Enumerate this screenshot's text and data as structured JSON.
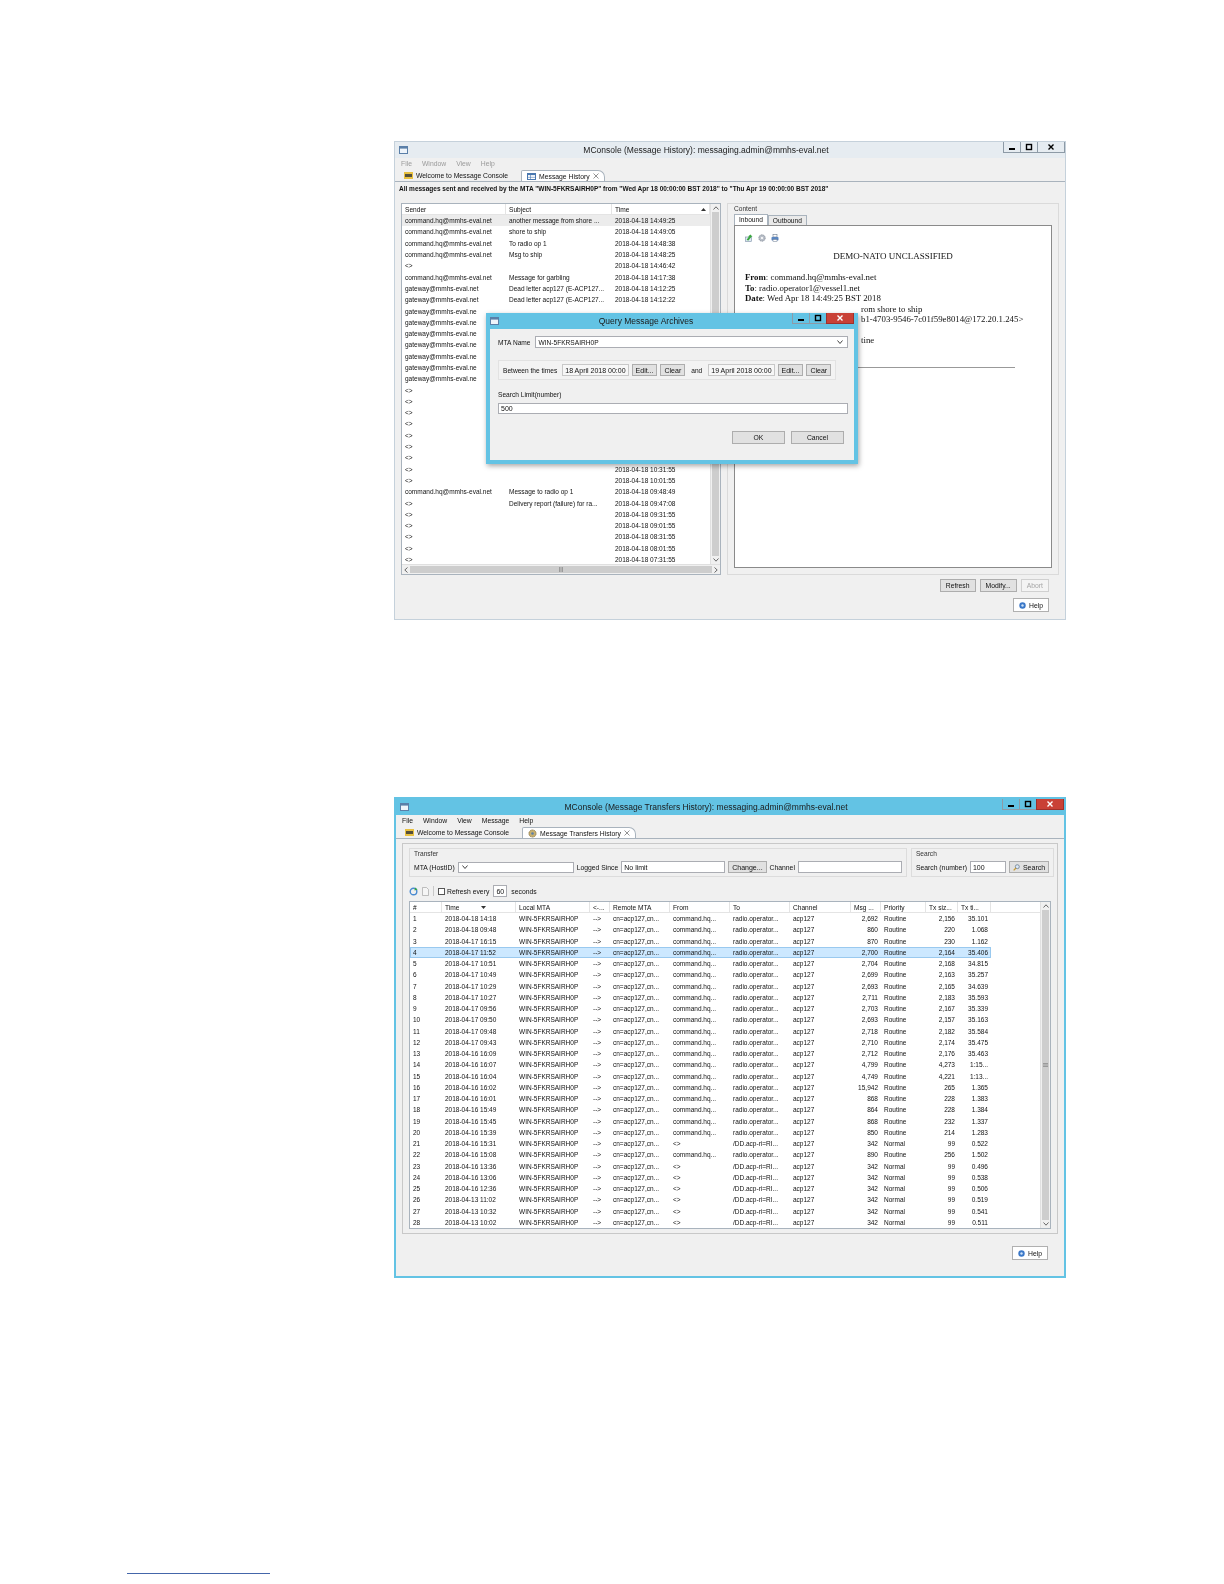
{
  "message_history_window": {
    "title": "MConsole (Message History): messaging.admin@mmhs-eval.net",
    "active": false,
    "menu": [
      {
        "label": "File",
        "disabled": true
      },
      {
        "label": "Window",
        "disabled": true
      },
      {
        "label": "View",
        "disabled": true
      },
      {
        "label": "Help",
        "disabled": true
      }
    ],
    "tabs": [
      {
        "label": "Welcome to Message Console",
        "selected": false,
        "closable": false
      },
      {
        "label": "Message History",
        "selected": true,
        "closable": true
      }
    ],
    "summary": "All messages sent and received by the MTA \"WIN-5FKRSAIRH0P\" from \"Wed Apr 18 00:00:00 BST 2018\" to \"Thu Apr 19 00:00:00 BST 2018\"",
    "table": {
      "columns": [
        {
          "label": "Sender",
          "sorted": false
        },
        {
          "label": "Subject",
          "sorted": false
        },
        {
          "label": "Time",
          "sorted": true,
          "descending": false
        }
      ],
      "rows": [
        {
          "sender": "command.hq@mmhs-eval.net",
          "subject": "another message from shore ...",
          "time": "2018-04-18 14:49:25",
          "selected": true
        },
        {
          "sender": "command.hq@mmhs-eval.net",
          "subject": "shore to ship",
          "time": "2018-04-18 14:49:05",
          "selected": false
        },
        {
          "sender": "command.hq@mmhs-eval.net",
          "subject": "To radio op 1",
          "time": "2018-04-18 14:48:38",
          "selected": false
        },
        {
          "sender": "command.hq@mmhs-eval.net",
          "subject": "Msg to ship",
          "time": "2018-04-18 14:48:25",
          "selected": false
        },
        {
          "sender": "<>",
          "time": "2018-04-18 14:46:42",
          "selected": false
        },
        {
          "sender": "command.hq@mmhs-eval.net",
          "subject": "Message for garbling",
          "time": "2018-04-18 14:17:38",
          "selected": false
        },
        {
          "sender": "gateway@mmhs-eval.net",
          "subject": "Dead letter acp127 (E-ACP127...",
          "time": "2018-04-18 14:12:25",
          "selected": false
        },
        {
          "sender": "gateway@mmhs-eval.net",
          "subject": "Dead letter acp127 (E-ACP127...",
          "time": "2018-04-18 14:12:22",
          "selected": false
        },
        {
          "sender": "gateway@mmhs-eval.ne",
          "selected": false
        },
        {
          "sender": "gateway@mmhs-eval.ne",
          "selected": false
        },
        {
          "sender": "gateway@mmhs-eval.ne",
          "selected": false
        },
        {
          "sender": "gateway@mmhs-eval.ne",
          "selected": false
        },
        {
          "sender": "gateway@mmhs-eval.ne",
          "selected": false
        },
        {
          "sender": "gateway@mmhs-eval.ne",
          "selected": false
        },
        {
          "sender": "gateway@mmhs-eval.ne",
          "selected": false
        },
        {
          "sender": "<>",
          "selected": false
        },
        {
          "sender": "<>",
          "selected": false
        },
        {
          "sender": "<>",
          "selected": false
        },
        {
          "sender": "<>",
          "selected": false
        },
        {
          "sender": "<>",
          "selected": false
        },
        {
          "sender": "<>",
          "selected": false
        },
        {
          "sender": "<>",
          "selected": false
        },
        {
          "sender": "<>",
          "time": "2018-04-18 10:31:55",
          "selected": false
        },
        {
          "sender": "<>",
          "time": "2018-04-18 10:01:55",
          "selected": false
        },
        {
          "sender": "command.hq@mmhs-eval.net",
          "subject": "Message to radio op 1",
          "time": "2018-04-18 09:48:49",
          "selected": false
        },
        {
          "sender": "<>",
          "subject": "Delivery report (failure) for ra...",
          "time": "2018-04-18 09:47:08",
          "selected": false
        },
        {
          "sender": "<>",
          "time": "2018-04-18 09:31:55",
          "selected": false
        },
        {
          "sender": "<>",
          "time": "2018-04-18 09:01:55",
          "selected": false
        },
        {
          "sender": "<>",
          "time": "2018-04-18 08:31:55",
          "selected": false
        },
        {
          "sender": "<>",
          "time": "2018-04-18 08:01:55",
          "selected": false
        },
        {
          "sender": "<>",
          "time": "2018-04-18 07:31:55",
          "selected": false
        }
      ]
    },
    "content": {
      "label": "Content",
      "tabs": [
        {
          "label": "Inbound",
          "selected": true
        },
        {
          "label": "Outbound",
          "selected": false
        }
      ],
      "classification": "DEMO-NATO UNCLASSIFIED",
      "header_lines": [
        "**From**: command.hq@mmhs-eval.net",
        "**To**: radio.operator1@vessel1.net",
        "**Date**: Wed Apr 18 14:49:25 BST 2018"
      ],
      "covered_lines": [
        "rom shore to ship",
        "b1-4703-9546-7c01f59e8014@172.20.1.245>",
        "tine"
      ]
    },
    "buttons": [
      {
        "label": "Refresh",
        "disabled": false
      },
      {
        "label": "Modify...",
        "disabled": false
      },
      {
        "label": "Abort",
        "disabled": true
      }
    ],
    "help_button": "Help",
    "dialog": {
      "title": "Query Message Archives",
      "active": true,
      "mta_label": "MTA Name",
      "mta_value": "WIN-5FKRSAIRH0P",
      "between_label": "Between the times",
      "and_label": "and",
      "range": [
        {
          "value": "18 April 2018 00:00",
          "edit": "Edit...",
          "clear": "Clear"
        },
        {
          "value": "19 April 2018 00:00",
          "edit": "Edit...",
          "clear": "Clear"
        }
      ],
      "limit_label": "Search Limit(number)",
      "limit_value": "500",
      "buttons": [
        "OK",
        "Cancel"
      ]
    }
  },
  "transfers_window": {
    "title": "MConsole (Message Transfers History): messaging.admin@mmhs-eval.net",
    "active": true,
    "menu": [
      {
        "label": "File",
        "disabled": false
      },
      {
        "label": "Window",
        "disabled": false
      },
      {
        "label": "View",
        "disabled": false
      },
      {
        "label": "Message",
        "disabled": false
      },
      {
        "label": "Help",
        "disabled": false
      }
    ],
    "tabs": [
      {
        "label": "Welcome to Message Console",
        "selected": false,
        "closable": false
      },
      {
        "label": "Message Transfers History",
        "selected": true,
        "closable": true
      }
    ],
    "transfer_group": {
      "label": "Transfer",
      "host_label": "MTA (HostID)",
      "since_label": "Logged Since",
      "since_value": "No limit",
      "change_button": "Change...",
      "channel_label": "Channel"
    },
    "search_group": {
      "label": "Search",
      "number_label": "Search (number)",
      "number_value": "100",
      "search_button": "Search"
    },
    "refresh": {
      "label": "Refresh every",
      "checked": false,
      "interval": "60",
      "unit": "seconds"
    },
    "table": {
      "columns": [
        {
          "label": "#",
          "sorted": false
        },
        {
          "label": "Time",
          "sorted": true,
          "descending": true
        },
        {
          "label": "Local MTA",
          "sorted": false
        },
        {
          "label": "<-...",
          "sorted": false
        },
        {
          "label": "Remote MTA",
          "sorted": false
        },
        {
          "label": "From",
          "sorted": false
        },
        {
          "label": "To",
          "sorted": false
        },
        {
          "label": "Channel",
          "sorted": false
        },
        {
          "label": "Msg ...",
          "sorted": false
        },
        {
          "label": "Priority",
          "sorted": false
        },
        {
          "label": "Tx siz...",
          "sorted": false
        },
        {
          "label": "Tx ti...",
          "sorted": false
        }
      ],
      "rows": [
        {
          "cells": [
            "1",
            "2018-04-18 14:18",
            "WIN-5FKRSAIRH0P",
            "-->",
            "cn=acp127,cn...",
            "command.hq...",
            "radio.operator...",
            "acp127",
            "2,692",
            "Routine",
            "2,156",
            "35.101"
          ],
          "selected": false
        },
        {
          "cells": [
            "2",
            "2018-04-18 09:48",
            "WIN-5FKRSAIRH0P",
            "-->",
            "cn=acp127,cn...",
            "command.hq...",
            "radio.operator...",
            "acp127",
            "860",
            "Routine",
            "220",
            "1.068"
          ],
          "selected": false
        },
        {
          "cells": [
            "3",
            "2018-04-17 16:15",
            "WIN-5FKRSAIRH0P",
            "-->",
            "cn=acp127,cn...",
            "command.hq...",
            "radio.operator...",
            "acp127",
            "870",
            "Routine",
            "230",
            "1.162"
          ],
          "selected": false
        },
        {
          "cells": [
            "4",
            "2018-04-17 11:52",
            "WIN-5FKRSAIRH0P",
            "-->",
            "cn=acp127,cn...",
            "command.hq...",
            "radio.operator...",
            "acp127",
            "2,700",
            "Routine",
            "2,164",
            "35.406"
          ],
          "selected": true
        },
        {
          "cells": [
            "5",
            "2018-04-17 10:51",
            "WIN-5FKRSAIRH0P",
            "-->",
            "cn=acp127,cn...",
            "command.hq...",
            "radio.operator...",
            "acp127",
            "2,704",
            "Routine",
            "2,168",
            "34.815"
          ],
          "selected": false
        },
        {
          "cells": [
            "6",
            "2018-04-17 10:49",
            "WIN-5FKRSAIRH0P",
            "-->",
            "cn=acp127,cn...",
            "command.hq...",
            "radio.operator...",
            "acp127",
            "2,699",
            "Routine",
            "2,163",
            "35.257"
          ],
          "selected": false
        },
        {
          "cells": [
            "7",
            "2018-04-17 10:29",
            "WIN-5FKRSAIRH0P",
            "-->",
            "cn=acp127,cn...",
            "command.hq...",
            "radio.operator...",
            "acp127",
            "2,693",
            "Routine",
            "2,165",
            "34.639"
          ],
          "selected": false
        },
        {
          "cells": [
            "8",
            "2018-04-17 10:27",
            "WIN-5FKRSAIRH0P",
            "-->",
            "cn=acp127,cn...",
            "command.hq...",
            "radio.operator...",
            "acp127",
            "2,711",
            "Routine",
            "2,183",
            "35.593"
          ],
          "selected": false
        },
        {
          "cells": [
            "9",
            "2018-04-17 09:56",
            "WIN-5FKRSAIRH0P",
            "-->",
            "cn=acp127,cn...",
            "command.hq...",
            "radio.operator...",
            "acp127",
            "2,703",
            "Routine",
            "2,167",
            "35.339"
          ],
          "selected": false
        },
        {
          "cells": [
            "10",
            "2018-04-17 09:50",
            "WIN-5FKRSAIRH0P",
            "-->",
            "cn=acp127,cn...",
            "command.hq...",
            "radio.operator...",
            "acp127",
            "2,693",
            "Routine",
            "2,157",
            "35.163"
          ],
          "selected": false
        },
        {
          "cells": [
            "11",
            "2018-04-17 09:48",
            "WIN-5FKRSAIRH0P",
            "-->",
            "cn=acp127,cn...",
            "command.hq...",
            "radio.operator...",
            "acp127",
            "2,718",
            "Routine",
            "2,182",
            "35.584"
          ],
          "selected": false
        },
        {
          "cells": [
            "12",
            "2018-04-17 09:43",
            "WIN-5FKRSAIRH0P",
            "-->",
            "cn=acp127,cn...",
            "command.hq...",
            "radio.operator...",
            "acp127",
            "2,710",
            "Routine",
            "2,174",
            "35.475"
          ],
          "selected": false
        },
        {
          "cells": [
            "13",
            "2018-04-16 16:09",
            "WIN-5FKRSAIRH0P",
            "-->",
            "cn=acp127,cn...",
            "command.hq...",
            "radio.operator...",
            "acp127",
            "2,712",
            "Routine",
            "2,176",
            "35.463"
          ],
          "selected": false
        },
        {
          "cells": [
            "14",
            "2018-04-16 16:07",
            "WIN-5FKRSAIRH0P",
            "-->",
            "cn=acp127,cn...",
            "command.hq...",
            "radio.operator...",
            "acp127",
            "4,799",
            "Routine",
            "4,273",
            "1:15..."
          ],
          "selected": false
        },
        {
          "cells": [
            "15",
            "2018-04-16 16:04",
            "WIN-5FKRSAIRH0P",
            "-->",
            "cn=acp127,cn...",
            "command.hq...",
            "radio.operator...",
            "acp127",
            "4,749",
            "Routine",
            "4,221",
            "1:13..."
          ],
          "selected": false
        },
        {
          "cells": [
            "16",
            "2018-04-16 16:02",
            "WIN-5FKRSAIRH0P",
            "-->",
            "cn=acp127,cn...",
            "command.hq...",
            "radio.operator...",
            "acp127",
            "15,942",
            "Routine",
            "265",
            "1.365"
          ],
          "selected": false
        },
        {
          "cells": [
            "17",
            "2018-04-16 16:01",
            "WIN-5FKRSAIRH0P",
            "-->",
            "cn=acp127,cn...",
            "command.hq...",
            "radio.operator...",
            "acp127",
            "868",
            "Routine",
            "228",
            "1.383"
          ],
          "selected": false
        },
        {
          "cells": [
            "18",
            "2018-04-16 15:49",
            "WIN-5FKRSAIRH0P",
            "-->",
            "cn=acp127,cn...",
            "command.hq...",
            "radio.operator...",
            "acp127",
            "864",
            "Routine",
            "228",
            "1.384"
          ],
          "selected": false
        },
        {
          "cells": [
            "19",
            "2018-04-16 15:45",
            "WIN-5FKRSAIRH0P",
            "-->",
            "cn=acp127,cn...",
            "command.hq...",
            "radio.operator...",
            "acp127",
            "868",
            "Routine",
            "232",
            "1.337"
          ],
          "selected": false
        },
        {
          "cells": [
            "20",
            "2018-04-16 15:39",
            "WIN-5FKRSAIRH0P",
            "-->",
            "cn=acp127,cn...",
            "command.hq...",
            "radio.operator...",
            "acp127",
            "850",
            "Routine",
            "214",
            "1.283"
          ],
          "selected": false
        },
        {
          "cells": [
            "21",
            "2018-04-16 15:31",
            "WIN-5FKRSAIRH0P",
            "-->",
            "cn=acp127,cn...",
            "<>",
            "/DD.acp-ri=RI...",
            "acp127",
            "342",
            "Normal",
            "99",
            "0.522"
          ],
          "selected": false
        },
        {
          "cells": [
            "22",
            "2018-04-16 15:08",
            "WIN-5FKRSAIRH0P",
            "-->",
            "cn=acp127,cn...",
            "command.hq...",
            "radio.operator...",
            "acp127",
            "890",
            "Routine",
            "256",
            "1.502"
          ],
          "selected": false
        },
        {
          "cells": [
            "23",
            "2018-04-16 13:36",
            "WIN-5FKRSAIRH0P",
            "-->",
            "cn=acp127,cn...",
            "<>",
            "/DD.acp-ri=RI...",
            "acp127",
            "342",
            "Normal",
            "99",
            "0.496"
          ],
          "selected": false
        },
        {
          "cells": [
            "24",
            "2018-04-16 13:06",
            "WIN-5FKRSAIRH0P",
            "-->",
            "cn=acp127,cn...",
            "<>",
            "/DD.acp-ri=RI...",
            "acp127",
            "342",
            "Normal",
            "99",
            "0.538"
          ],
          "selected": false
        },
        {
          "cells": [
            "25",
            "2018-04-16 12:36",
            "WIN-5FKRSAIRH0P",
            "-->",
            "cn=acp127,cn...",
            "<>",
            "/DD.acp-ri=RI...",
            "acp127",
            "342",
            "Normal",
            "99",
            "0.506"
          ],
          "selected": false
        },
        {
          "cells": [
            "26",
            "2018-04-13 11:02",
            "WIN-5FKRSAIRH0P",
            "-->",
            "cn=acp127,cn...",
            "<>",
            "/DD.acp-ri=RI...",
            "acp127",
            "342",
            "Normal",
            "99",
            "0.519"
          ],
          "selected": false
        },
        {
          "cells": [
            "27",
            "2018-04-13 10:32",
            "WIN-5FKRSAIRH0P",
            "-->",
            "cn=acp127,cn...",
            "<>",
            "/DD.acp-ri=RI...",
            "acp127",
            "342",
            "Normal",
            "99",
            "0.541"
          ],
          "selected": false
        },
        {
          "cells": [
            "28",
            "2018-04-13 10:02",
            "WIN-5FKRSAIRH0P",
            "-->",
            "cn=acp127,cn...",
            "<>",
            "/DD.acp-ri=RI...",
            "acp127",
            "342",
            "Normal",
            "99",
            "0.511"
          ],
          "selected": false
        }
      ]
    },
    "help_button": "Help"
  }
}
